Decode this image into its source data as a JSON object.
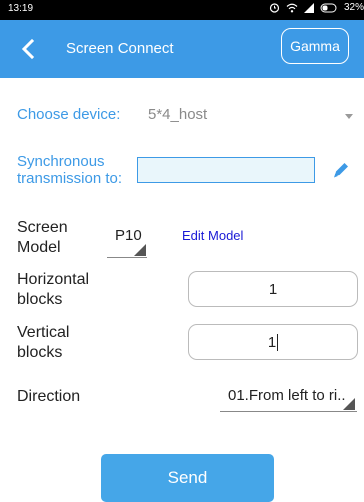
{
  "status_bar": {
    "time": "13:19",
    "battery": "32%",
    "icons": [
      "alarm-icon",
      "wifi-icon",
      "signal-icon",
      "battery-icon"
    ]
  },
  "header": {
    "title": "Screen Connect",
    "gamma_label": "Gamma",
    "background": "#3d9ae6"
  },
  "form": {
    "choose_device_label": "Choose device:",
    "device_value": "5*4_host",
    "sync_label_line1": "Synchronous",
    "sync_label_line2": "transmission to:",
    "sync_value": "",
    "screen_model_label_line1": "Screen",
    "screen_model_label_line2": "Model",
    "screen_model_value": "P10",
    "edit_model_label": "Edit Model",
    "horizontal_label_line1": "Horizontal",
    "horizontal_label_line2": "blocks",
    "horizontal_value": "1",
    "vertical_label_line1": "Vertical",
    "vertical_label_line2": "blocks",
    "vertical_value": "1",
    "direction_label": "Direction",
    "direction_value": "01.From left to ri.."
  },
  "actions": {
    "send_label": "Send"
  },
  "colors": {
    "accent": "#3d9ae6",
    "link": "#1a1ad6",
    "button": "#45a6e8"
  }
}
